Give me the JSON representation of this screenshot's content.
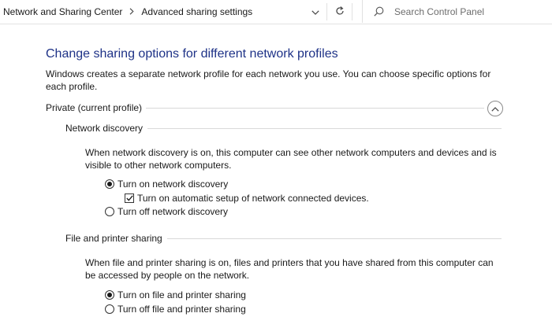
{
  "address_bar": {
    "breadcrumbs": [
      "Network and Sharing Center",
      "Advanced sharing settings"
    ],
    "search_placeholder": "Search Control Panel"
  },
  "page": {
    "title": "Change sharing options for different network profiles",
    "description": "Windows creates a separate network profile for each network you use. You can choose specific options for each profile."
  },
  "profile": {
    "name": "Private (current profile)",
    "expanded": true,
    "network_discovery": {
      "heading": "Network discovery",
      "description": "When network discovery is on, this computer can see other network computers and devices and is visible to other network computers.",
      "options": [
        {
          "label": "Turn on network discovery",
          "selected": true
        },
        {
          "label": "Turn off network discovery",
          "selected": false
        }
      ],
      "auto_setup": {
        "label": "Turn on automatic setup of network connected devices.",
        "checked": true
      }
    },
    "file_printer_sharing": {
      "heading": "File and printer sharing",
      "description": "When file and printer sharing is on, files and printers that you have shared from this computer can be accessed by people on the network.",
      "options": [
        {
          "label": "Turn on file and printer sharing",
          "selected": true
        },
        {
          "label": "Turn off file and printer sharing",
          "selected": false
        }
      ]
    }
  },
  "icons": {
    "history": "chevron-down-icon",
    "refresh": "refresh-icon",
    "search": "search-icon",
    "collapse": "chevron-up-icon",
    "breadcrumb_separator": "chevron-right-icon"
  }
}
